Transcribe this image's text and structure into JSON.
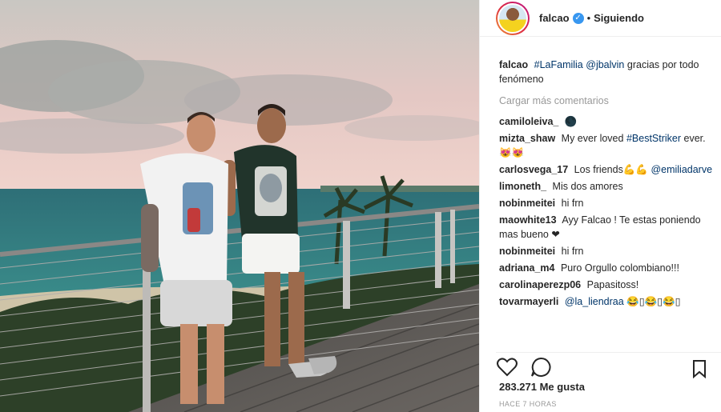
{
  "post": {
    "author": "falcao",
    "follow_status": "Siguiendo",
    "separator": "•",
    "verified_mark": "✓"
  },
  "caption": {
    "user": "falcao",
    "hashtag": "#LaFamilia",
    "mention": "@jbalvin",
    "text": "gracias por todo fenómeno"
  },
  "load_more": "Cargar más comentarios",
  "comments": [
    {
      "user": "camiloleiva_",
      "text": "🌑"
    },
    {
      "user": "mizta_shaw",
      "text": "My ever loved",
      "tag": "#BestStriker",
      "text2": "ever. 😻😻"
    },
    {
      "user": "carlosvega_17",
      "text": "Los friends💪💪",
      "tag": "@emiliadarve"
    },
    {
      "user": "limoneth_",
      "text": "Mis dos amores"
    },
    {
      "user": "nobinmeitei",
      "text": "hi frn"
    },
    {
      "user": "maowhite13",
      "text": "Ayy Falcao ! Te estas poniendo mas bueno ❤"
    },
    {
      "user": "nobinmeitei",
      "text": "hi frn"
    },
    {
      "user": "adriana_m4",
      "text": "Puro Orgullo colombiano!!!"
    },
    {
      "user": "carolinaperezp06",
      "text": "Papasitoss!"
    },
    {
      "user": "tovarmayerli",
      "tag": "@la_liendraa",
      "text": "😂▯😂▯😂▯"
    }
  ],
  "likes": "283.271 Me gusta",
  "time": "HACE 7 HORAS",
  "icons": {
    "like": "heart-icon",
    "comment": "comment-icon",
    "save": "bookmark-icon"
  },
  "colors": {
    "link": "#003569",
    "verified": "#3897f0",
    "muted": "#999999"
  }
}
